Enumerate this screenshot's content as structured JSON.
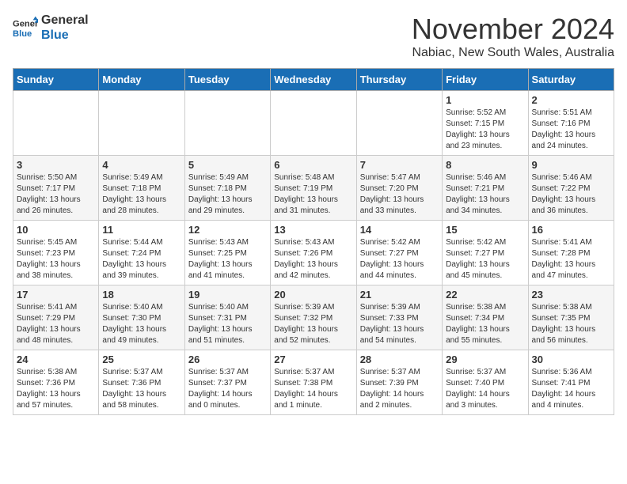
{
  "header": {
    "logo_line1": "General",
    "logo_line2": "Blue",
    "month": "November 2024",
    "location": "Nabiac, New South Wales, Australia"
  },
  "weekdays": [
    "Sunday",
    "Monday",
    "Tuesday",
    "Wednesday",
    "Thursday",
    "Friday",
    "Saturday"
  ],
  "weeks": [
    [
      {
        "day": "",
        "info": ""
      },
      {
        "day": "",
        "info": ""
      },
      {
        "day": "",
        "info": ""
      },
      {
        "day": "",
        "info": ""
      },
      {
        "day": "",
        "info": ""
      },
      {
        "day": "1",
        "info": "Sunrise: 5:52 AM\nSunset: 7:15 PM\nDaylight: 13 hours\nand 23 minutes."
      },
      {
        "day": "2",
        "info": "Sunrise: 5:51 AM\nSunset: 7:16 PM\nDaylight: 13 hours\nand 24 minutes."
      }
    ],
    [
      {
        "day": "3",
        "info": "Sunrise: 5:50 AM\nSunset: 7:17 PM\nDaylight: 13 hours\nand 26 minutes."
      },
      {
        "day": "4",
        "info": "Sunrise: 5:49 AM\nSunset: 7:18 PM\nDaylight: 13 hours\nand 28 minutes."
      },
      {
        "day": "5",
        "info": "Sunrise: 5:49 AM\nSunset: 7:18 PM\nDaylight: 13 hours\nand 29 minutes."
      },
      {
        "day": "6",
        "info": "Sunrise: 5:48 AM\nSunset: 7:19 PM\nDaylight: 13 hours\nand 31 minutes."
      },
      {
        "day": "7",
        "info": "Sunrise: 5:47 AM\nSunset: 7:20 PM\nDaylight: 13 hours\nand 33 minutes."
      },
      {
        "day": "8",
        "info": "Sunrise: 5:46 AM\nSunset: 7:21 PM\nDaylight: 13 hours\nand 34 minutes."
      },
      {
        "day": "9",
        "info": "Sunrise: 5:46 AM\nSunset: 7:22 PM\nDaylight: 13 hours\nand 36 minutes."
      }
    ],
    [
      {
        "day": "10",
        "info": "Sunrise: 5:45 AM\nSunset: 7:23 PM\nDaylight: 13 hours\nand 38 minutes."
      },
      {
        "day": "11",
        "info": "Sunrise: 5:44 AM\nSunset: 7:24 PM\nDaylight: 13 hours\nand 39 minutes."
      },
      {
        "day": "12",
        "info": "Sunrise: 5:43 AM\nSunset: 7:25 PM\nDaylight: 13 hours\nand 41 minutes."
      },
      {
        "day": "13",
        "info": "Sunrise: 5:43 AM\nSunset: 7:26 PM\nDaylight: 13 hours\nand 42 minutes."
      },
      {
        "day": "14",
        "info": "Sunrise: 5:42 AM\nSunset: 7:27 PM\nDaylight: 13 hours\nand 44 minutes."
      },
      {
        "day": "15",
        "info": "Sunrise: 5:42 AM\nSunset: 7:27 PM\nDaylight: 13 hours\nand 45 minutes."
      },
      {
        "day": "16",
        "info": "Sunrise: 5:41 AM\nSunset: 7:28 PM\nDaylight: 13 hours\nand 47 minutes."
      }
    ],
    [
      {
        "day": "17",
        "info": "Sunrise: 5:41 AM\nSunset: 7:29 PM\nDaylight: 13 hours\nand 48 minutes."
      },
      {
        "day": "18",
        "info": "Sunrise: 5:40 AM\nSunset: 7:30 PM\nDaylight: 13 hours\nand 49 minutes."
      },
      {
        "day": "19",
        "info": "Sunrise: 5:40 AM\nSunset: 7:31 PM\nDaylight: 13 hours\nand 51 minutes."
      },
      {
        "day": "20",
        "info": "Sunrise: 5:39 AM\nSunset: 7:32 PM\nDaylight: 13 hours\nand 52 minutes."
      },
      {
        "day": "21",
        "info": "Sunrise: 5:39 AM\nSunset: 7:33 PM\nDaylight: 13 hours\nand 54 minutes."
      },
      {
        "day": "22",
        "info": "Sunrise: 5:38 AM\nSunset: 7:34 PM\nDaylight: 13 hours\nand 55 minutes."
      },
      {
        "day": "23",
        "info": "Sunrise: 5:38 AM\nSunset: 7:35 PM\nDaylight: 13 hours\nand 56 minutes."
      }
    ],
    [
      {
        "day": "24",
        "info": "Sunrise: 5:38 AM\nSunset: 7:36 PM\nDaylight: 13 hours\nand 57 minutes."
      },
      {
        "day": "25",
        "info": "Sunrise: 5:37 AM\nSunset: 7:36 PM\nDaylight: 13 hours\nand 58 minutes."
      },
      {
        "day": "26",
        "info": "Sunrise: 5:37 AM\nSunset: 7:37 PM\nDaylight: 14 hours\nand 0 minutes."
      },
      {
        "day": "27",
        "info": "Sunrise: 5:37 AM\nSunset: 7:38 PM\nDaylight: 14 hours\nand 1 minute."
      },
      {
        "day": "28",
        "info": "Sunrise: 5:37 AM\nSunset: 7:39 PM\nDaylight: 14 hours\nand 2 minutes."
      },
      {
        "day": "29",
        "info": "Sunrise: 5:37 AM\nSunset: 7:40 PM\nDaylight: 14 hours\nand 3 minutes."
      },
      {
        "day": "30",
        "info": "Sunrise: 5:36 AM\nSunset: 7:41 PM\nDaylight: 14 hours\nand 4 minutes."
      }
    ]
  ]
}
